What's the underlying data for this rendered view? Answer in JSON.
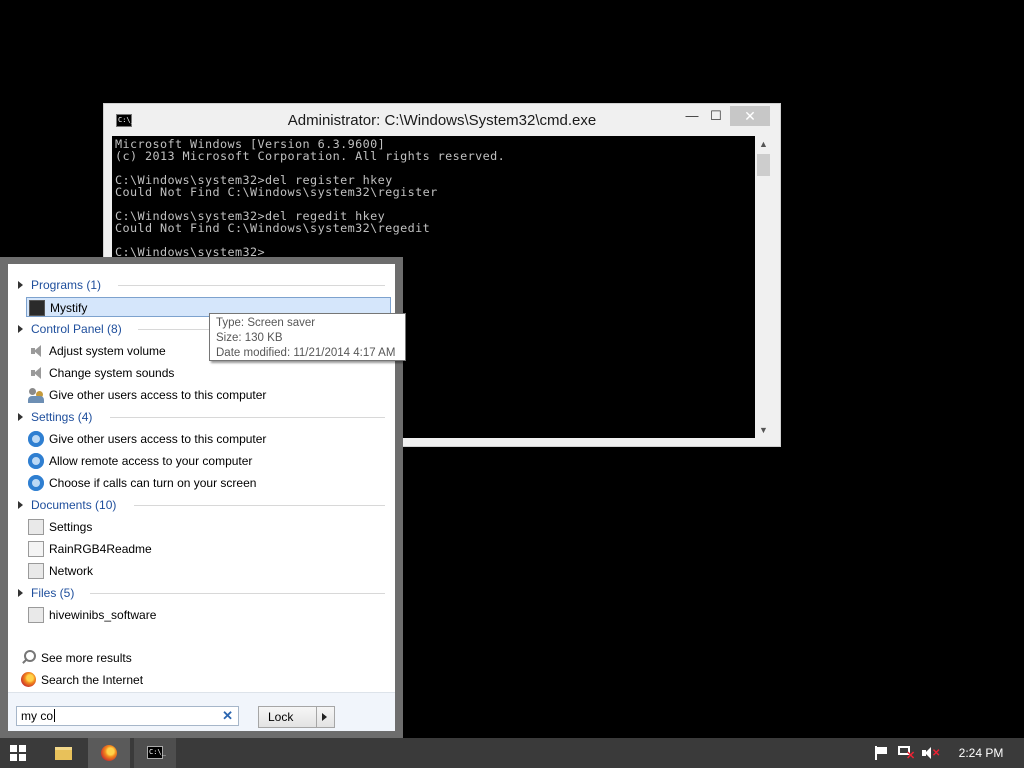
{
  "cmd_window": {
    "title": "Administrator: C:\\Windows\\System32\\cmd.exe",
    "icon_text": "C:\\_",
    "minimize": "—",
    "maximize": "☐",
    "close": "✕",
    "console_text": "Microsoft Windows [Version 6.3.9600]\n(c) 2013 Microsoft Corporation. All rights reserved.\n\nC:\\Windows\\system32>del register hkey\nCould Not Find C:\\Windows\\system32\\register\n\nC:\\Windows\\system32>del regedit hkey\nCould Not Find C:\\Windows\\system32\\regedit\n\nC:\\Windows\\system32>"
  },
  "start_menu": {
    "groups": {
      "programs": {
        "label": "Programs (1)",
        "items": [
          "Mystify"
        ]
      },
      "control_panel": {
        "label": "Control Panel (8)",
        "items": [
          "Adjust system volume",
          "Change system sounds",
          "Give other users access to this computer"
        ]
      },
      "settings": {
        "label": "Settings (4)",
        "items": [
          "Give other users access to this computer",
          "Allow remote access to your computer",
          "Choose if calls can turn on your screen"
        ]
      },
      "documents": {
        "label": "Documents (10)",
        "items": [
          "Settings",
          "RainRGB4Readme",
          "Network"
        ]
      },
      "files": {
        "label": "Files (5)",
        "items": [
          "hivewinibs_software"
        ]
      }
    },
    "see_more": "See more results",
    "search_internet": "Search the Internet",
    "search_value": "my co",
    "clear_icon": "✕",
    "lock_label": "Lock"
  },
  "tooltip": {
    "type": "Type: Screen saver",
    "size": "Size: 130 KB",
    "date": "Date modified: 11/21/2014 4:17 AM"
  },
  "taskbar": {
    "clock": "2:24 PM",
    "cmd_icon_text": "C:\\_"
  },
  "colors": {
    "group_header": "#1e4e9c",
    "selection": "#d5e6fb",
    "taskbar": "#3a3a3a"
  }
}
